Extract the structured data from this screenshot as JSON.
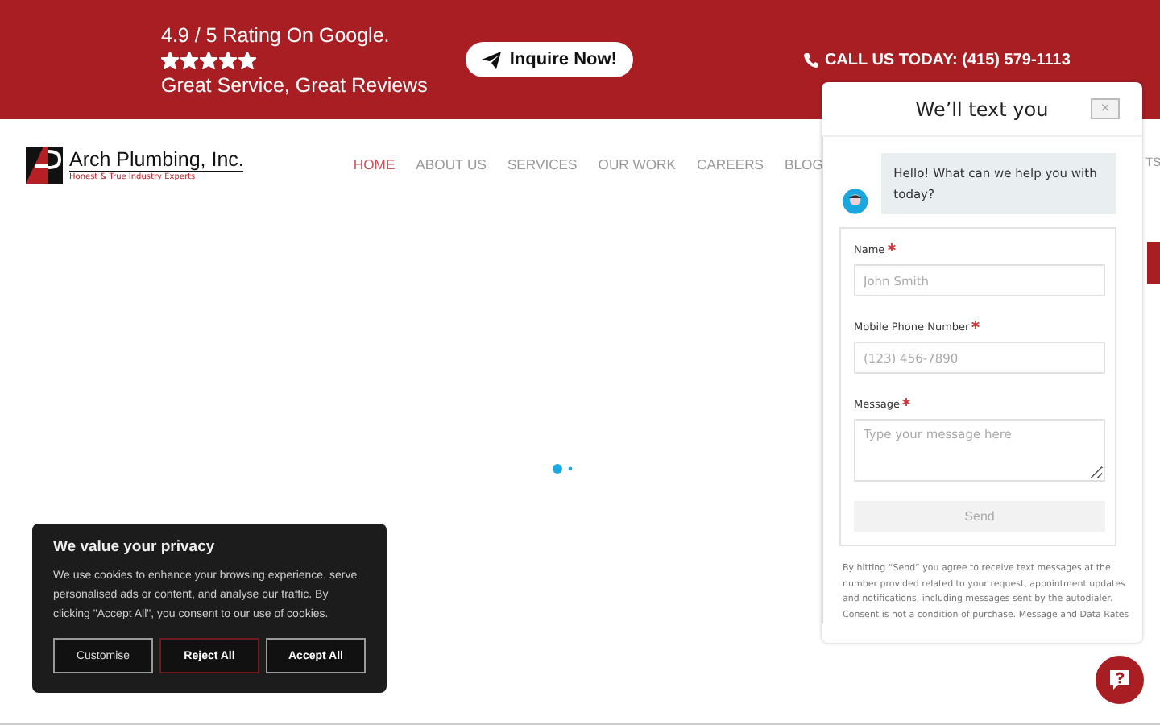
{
  "top_bar": {
    "rating": "4.9 / 5 Rating On Google.",
    "stars": 5,
    "tagline": "Great Service, Great Reviews",
    "inquire_button": "Inquire Now!",
    "call": "CALL US TODAY: (415) 579-1113"
  },
  "logo": {
    "name": "Arch Plumbing, Inc.",
    "slogan": "Honest & True Industry Experts"
  },
  "nav": [
    {
      "label": "HOME",
      "selected": true
    },
    {
      "label": "ABOUT US",
      "selected": false
    },
    {
      "label": "SERVICES",
      "selected": false
    },
    {
      "label": "OUR WORK",
      "selected": false
    },
    {
      "label": "CAREERS",
      "selected": false
    },
    {
      "label": "BLOG",
      "selected": false
    }
  ],
  "nav_cut_item": "TS",
  "chat": {
    "title": "We’ll text you",
    "close": "×",
    "greeting": "Hello! What can we help you with today?",
    "fields": [
      {
        "label": "Name",
        "required": true,
        "placeholder": "John Smith",
        "kind": "input"
      },
      {
        "label": "Mobile Phone Number",
        "required": true,
        "placeholder": "(123) 456-7890",
        "kind": "input"
      },
      {
        "label": "Message",
        "required": true,
        "placeholder": "Type your message here",
        "kind": "textarea"
      }
    ],
    "send": "Send",
    "disclaimer": "By hitting “Send” you agree to receive text messages at the number provided related to your request, appointment updates and notifications, including messages sent by the autodialer. Consent is not a condition of purchase. Message and Data Rates"
  },
  "cookies": {
    "title": "We value your privacy",
    "text": "We use cookies to enhance your browsing experience, serve personalised ads or content, and analyse our traffic. By clicking \"Accept All\", you consent to our use of cookies.",
    "buttons": [
      {
        "label": "Customise",
        "kind": "outline"
      },
      {
        "label": "Reject All",
        "kind": "reject"
      },
      {
        "label": "Accept All",
        "kind": "outline"
      }
    ]
  }
}
